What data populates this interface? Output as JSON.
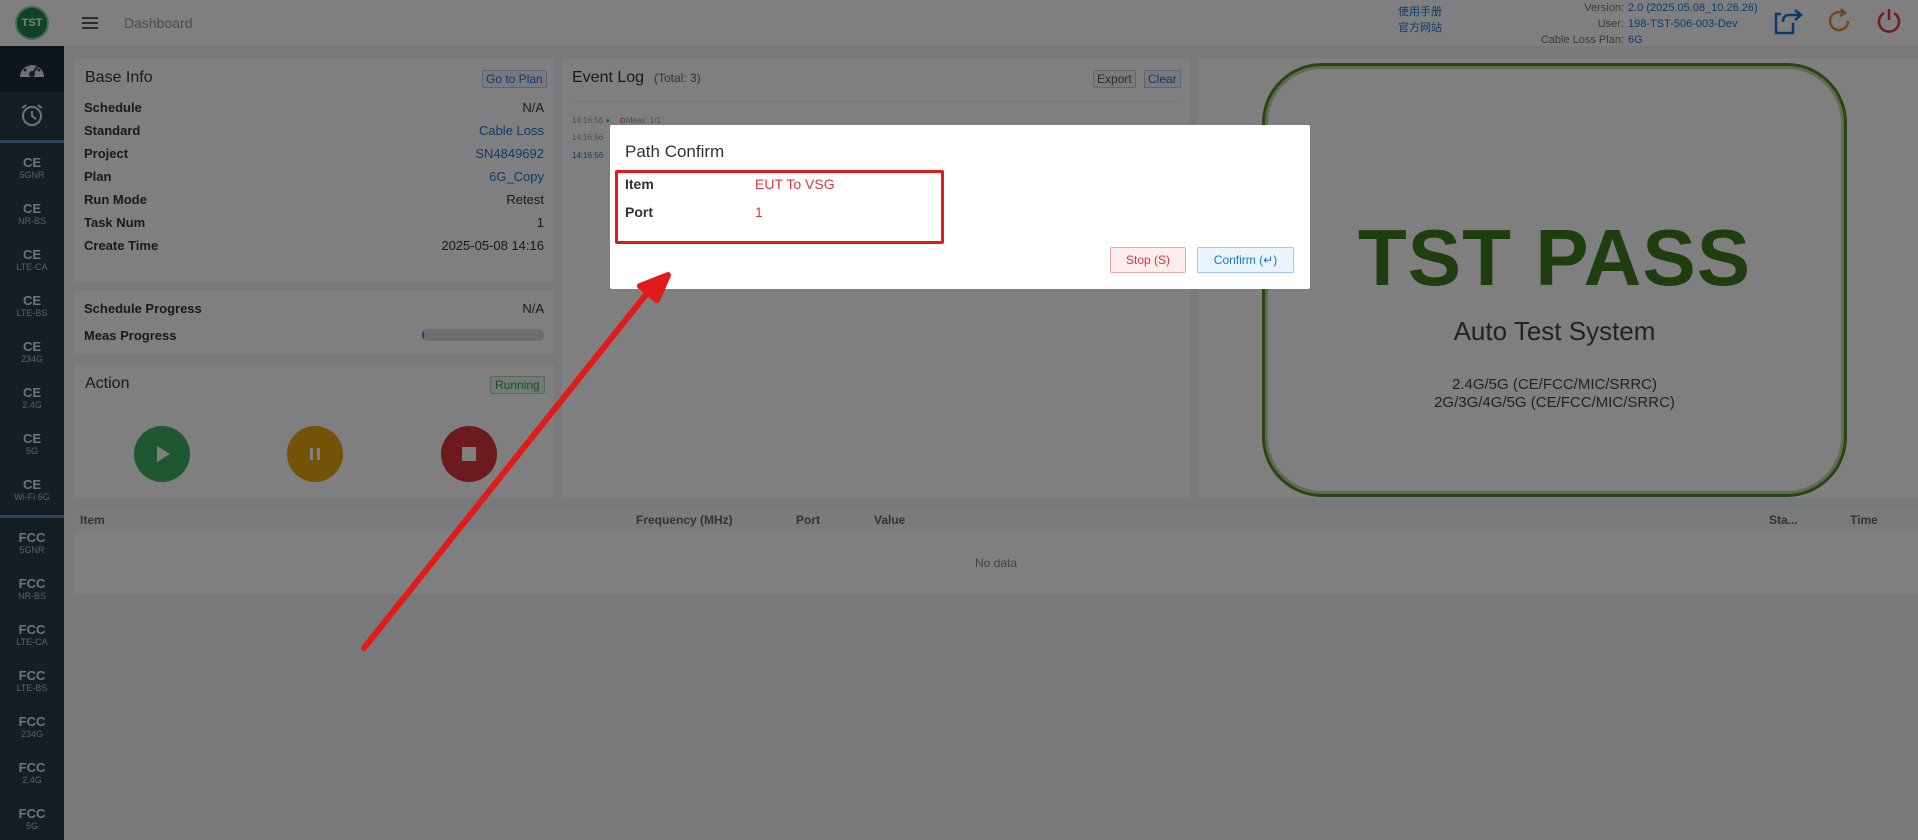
{
  "app": {
    "logo_text": "TST",
    "breadcrumb": "Dashboard"
  },
  "header": {
    "links": [
      "使用手册",
      "官方网站"
    ],
    "info": [
      {
        "key": "Version:",
        "value": "2.0 (2025.05.08_10.26.26)"
      },
      {
        "key": "User:",
        "value": "198-TST-506-003-Dev"
      },
      {
        "key": "Cable Loss Plan:",
        "value": "6G"
      }
    ],
    "icons": [
      "export-icon",
      "refresh-icon",
      "power-icon"
    ]
  },
  "sidebar": {
    "icon_items": [
      "dashboard-icon",
      "alarm-clock-icon"
    ],
    "ce_items": [
      {
        "main": "CE",
        "sub": "5GNR"
      },
      {
        "main": "CE",
        "sub": "NR-BS"
      },
      {
        "main": "CE",
        "sub": "LTE-CA"
      },
      {
        "main": "CE",
        "sub": "LTE-BS"
      },
      {
        "main": "CE",
        "sub": "234G"
      },
      {
        "main": "CE",
        "sub": "2.4G"
      },
      {
        "main": "CE",
        "sub": "5G"
      },
      {
        "main": "CE",
        "sub": "Wi-Fi 6G"
      }
    ],
    "fcc_items": [
      {
        "main": "FCC",
        "sub": "5GNR"
      },
      {
        "main": "FCC",
        "sub": "NR-BS"
      },
      {
        "main": "FCC",
        "sub": "LTE-CA"
      },
      {
        "main": "FCC",
        "sub": "LTE-BS"
      },
      {
        "main": "FCC",
        "sub": "234G"
      },
      {
        "main": "FCC",
        "sub": "2.4G"
      },
      {
        "main": "FCC",
        "sub": "5G"
      }
    ]
  },
  "base_info": {
    "title": "Base Info",
    "go_to_plan": "Go to Plan",
    "rows": [
      {
        "key": "Schedule",
        "value": "N/A",
        "link": false
      },
      {
        "key": "Standard",
        "value": "Cable Loss",
        "link": true
      },
      {
        "key": "Project",
        "value": "SN4849692",
        "link": true
      },
      {
        "key": "Plan",
        "value": "6G_Copy",
        "link": true
      },
      {
        "key": "Run Mode",
        "value": "Retest",
        "link": false
      },
      {
        "key": "Task Num",
        "value": "1",
        "link": false
      },
      {
        "key": "Create Time",
        "value": "2025-05-08 14:16",
        "link": false
      }
    ]
  },
  "progress": {
    "schedule_label": "Schedule Progress",
    "schedule_value": "N/A",
    "meas_label": "Meas Progress",
    "meas_fraction": 0.02
  },
  "action": {
    "title": "Action",
    "status": "Running",
    "buttons": [
      "play-button",
      "pause-button",
      "stop-button"
    ]
  },
  "event_log": {
    "title": "Event Log",
    "total": "(Total: 3)",
    "export": "Export",
    "clear": "Clear",
    "lines": [
      {
        "time": "14:16:56",
        "text": "Meas: 1/1"
      },
      {
        "time": "14:16:56",
        "text": ""
      },
      {
        "time": "14:16:56",
        "text": ""
      }
    ]
  },
  "brand": {
    "title": "TST PASS",
    "subtitle": "Auto Test System",
    "line1": "2.4G/5G (CE/FCC/MIC/SRRC)",
    "line2": "2G/3G/4G/5G (CE/FCC/MIC/SRRC)"
  },
  "results_table": {
    "headers": [
      "Item",
      "Frequency (MHz)",
      "Port",
      "Value",
      "Sta...",
      "Time"
    ],
    "empty_text": "No data"
  },
  "dialog": {
    "title": "Path Confirm",
    "rows": [
      {
        "key": "Item",
        "value": "EUT To VSG"
      },
      {
        "key": "Port",
        "value": "1"
      }
    ],
    "stop_label": "Stop (S)",
    "confirm_label": "Confirm (↵)"
  },
  "colors": {
    "accent": "#1976d2",
    "sidebar": "#2b3a4a",
    "brand_green": "#3e7a1e",
    "annotation_red": "#e11a1a"
  }
}
